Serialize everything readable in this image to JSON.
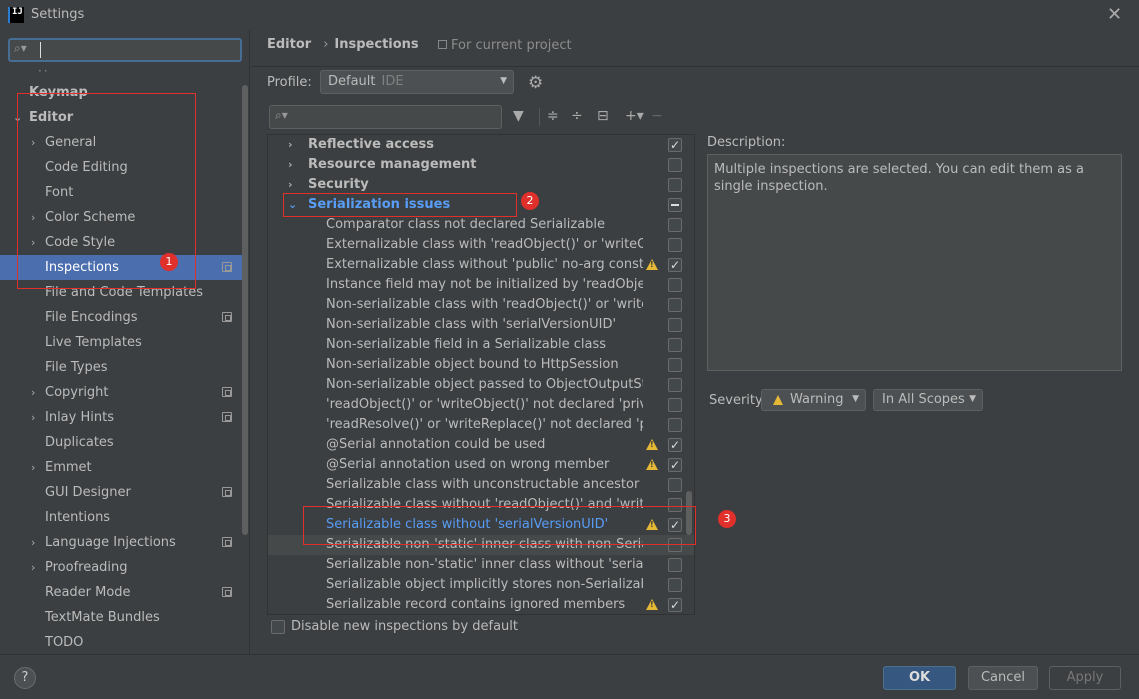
{
  "window": {
    "title": "Settings",
    "logo": "IJ"
  },
  "search": {
    "value": ""
  },
  "sidebar": {
    "items": [
      {
        "label": "Keymap",
        "bold": true,
        "chev": "",
        "indent": 0
      },
      {
        "label": "Editor",
        "bold": true,
        "chev": "⌄",
        "indent": 0
      },
      {
        "label": "General",
        "chev": "›",
        "indent": 1
      },
      {
        "label": "Code Editing",
        "chev": "",
        "indent": 1
      },
      {
        "label": "Font",
        "chev": "",
        "indent": 1
      },
      {
        "label": "Color Scheme",
        "chev": "›",
        "indent": 1
      },
      {
        "label": "Code Style",
        "chev": "›",
        "indent": 1
      },
      {
        "label": "Inspections",
        "chev": "",
        "indent": 1,
        "selected": true,
        "proj": true
      },
      {
        "label": "File and Code Templates",
        "chev": "",
        "indent": 1
      },
      {
        "label": "File Encodings",
        "chev": "",
        "indent": 1,
        "proj": true
      },
      {
        "label": "Live Templates",
        "chev": "",
        "indent": 1
      },
      {
        "label": "File Types",
        "chev": "",
        "indent": 1
      },
      {
        "label": "Copyright",
        "chev": "›",
        "indent": 1,
        "proj": true
      },
      {
        "label": "Inlay Hints",
        "chev": "›",
        "indent": 1,
        "proj": true
      },
      {
        "label": "Duplicates",
        "chev": "",
        "indent": 1
      },
      {
        "label": "Emmet",
        "chev": "›",
        "indent": 1
      },
      {
        "label": "GUI Designer",
        "chev": "",
        "indent": 1,
        "proj": true
      },
      {
        "label": "Intentions",
        "chev": "",
        "indent": 1
      },
      {
        "label": "Language Injections",
        "chev": "›",
        "indent": 1,
        "proj": true
      },
      {
        "label": "Proofreading",
        "chev": "›",
        "indent": 1
      },
      {
        "label": "Reader Mode",
        "chev": "",
        "indent": 1,
        "proj": true
      },
      {
        "label": "TextMate Bundles",
        "chev": "",
        "indent": 1
      },
      {
        "label": "TODO",
        "chev": "",
        "indent": 1
      }
    ]
  },
  "breadcrumb": {
    "part1": "Editor",
    "sep": "›",
    "part2": "Inspections",
    "scope": "For current project"
  },
  "profile": {
    "label": "Profile:",
    "value": "Default",
    "tag": "IDE"
  },
  "tree": {
    "rows": [
      {
        "label": "Reflective access",
        "type": "cat",
        "chev": "›",
        "check": "on"
      },
      {
        "label": "Resource management",
        "type": "cat",
        "chev": "›",
        "check": "off"
      },
      {
        "label": "Security",
        "type": "cat",
        "chev": "›",
        "check": "off"
      },
      {
        "label": "Serialization issues",
        "type": "cat",
        "chev": "⌄",
        "check": "ind",
        "link": true
      },
      {
        "label": "Comparator class not declared Serializable",
        "type": "leaf",
        "check": "off"
      },
      {
        "label": "Externalizable class with 'readObject()' or 'writeObject()'",
        "type": "leaf",
        "check": "off"
      },
      {
        "label": "Externalizable class without 'public' no-arg constructor",
        "type": "leaf",
        "check": "on",
        "warn": true
      },
      {
        "label": "Instance field may not be initialized by 'readObject()'",
        "type": "leaf",
        "check": "off"
      },
      {
        "label": "Non-serializable class with 'readObject()' or 'writeObject()'",
        "type": "leaf",
        "check": "off"
      },
      {
        "label": "Non-serializable class with 'serialVersionUID'",
        "type": "leaf",
        "check": "off"
      },
      {
        "label": "Non-serializable field in a Serializable class",
        "type": "leaf",
        "check": "off"
      },
      {
        "label": "Non-serializable object bound to HttpSession",
        "type": "leaf",
        "check": "off"
      },
      {
        "label": "Non-serializable object passed to ObjectOutputStream",
        "type": "leaf",
        "check": "off"
      },
      {
        "label": "'readObject()' or 'writeObject()' not declared 'private'",
        "type": "leaf",
        "check": "off"
      },
      {
        "label": "'readResolve()' or 'writeReplace()' not declared 'protected'",
        "type": "leaf",
        "check": "off"
      },
      {
        "label": "@Serial annotation could be used",
        "type": "leaf",
        "check": "on",
        "warn": true
      },
      {
        "label": "@Serial annotation used on wrong member",
        "type": "leaf",
        "check": "on",
        "warn": true
      },
      {
        "label": "Serializable class with unconstructable ancestor",
        "type": "leaf",
        "check": "off"
      },
      {
        "label": "Serializable class without 'readObject()' and 'writeObject()'",
        "type": "leaf",
        "check": "off"
      },
      {
        "label": "Serializable class without 'serialVersionUID'",
        "type": "leaf",
        "check": "on",
        "warn": true,
        "link": true
      },
      {
        "label": "Serializable non-'static' inner class with non-Serializable outer class",
        "type": "leaf",
        "check": "off",
        "hover": true
      },
      {
        "label": "Serializable non-'static' inner class without 'serialVersionUID'",
        "type": "leaf",
        "check": "off"
      },
      {
        "label": "Serializable object implicitly stores non-Serializable object",
        "type": "leaf",
        "check": "off"
      },
      {
        "label": "Serializable record contains ignored members",
        "type": "leaf",
        "check": "on",
        "warn": true
      }
    ]
  },
  "disable_new": {
    "label": "Disable new inspections by default"
  },
  "description": {
    "label": "Description:",
    "text": "Multiple inspections are selected. You can edit them as a single inspection."
  },
  "severity": {
    "label": "Severity:",
    "value": "Warning",
    "scope": "In All Scopes"
  },
  "buttons": {
    "help": "?",
    "ok": "OK",
    "cancel": "Cancel",
    "apply": "Apply"
  },
  "annotations": [
    "1",
    "2",
    "3"
  ],
  "colors": {
    "accent": "#4b6eaf",
    "link": "#589df6",
    "warning": "#e5b935",
    "annotation": "#e0302c"
  }
}
